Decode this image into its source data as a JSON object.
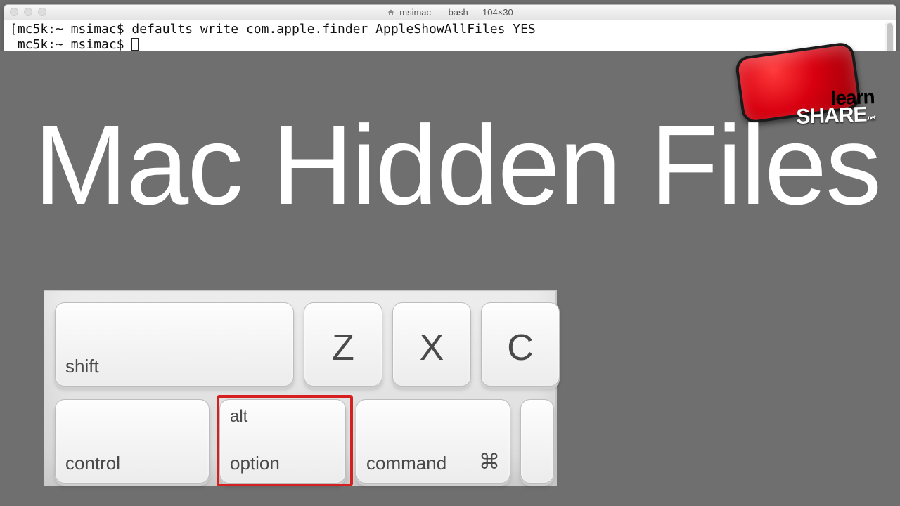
{
  "window": {
    "title": "msimac — -bash — 104×30"
  },
  "terminal": {
    "line1": "[mc5k:~ msimac$ defaults write com.apple.finder AppleShowAllFiles YES",
    "prompt2": " mc5k:~ msimac$ "
  },
  "title_text": "Mac Hidden Files",
  "logo": {
    "line1": "learn",
    "line2": "SHARE",
    "suffix": ".net"
  },
  "keys": {
    "shift": "shift",
    "z": "Z",
    "x": "X",
    "c": "C",
    "control": "control",
    "alt": "alt",
    "option": "option",
    "command": "command",
    "cmd_symbol": "⌘"
  }
}
